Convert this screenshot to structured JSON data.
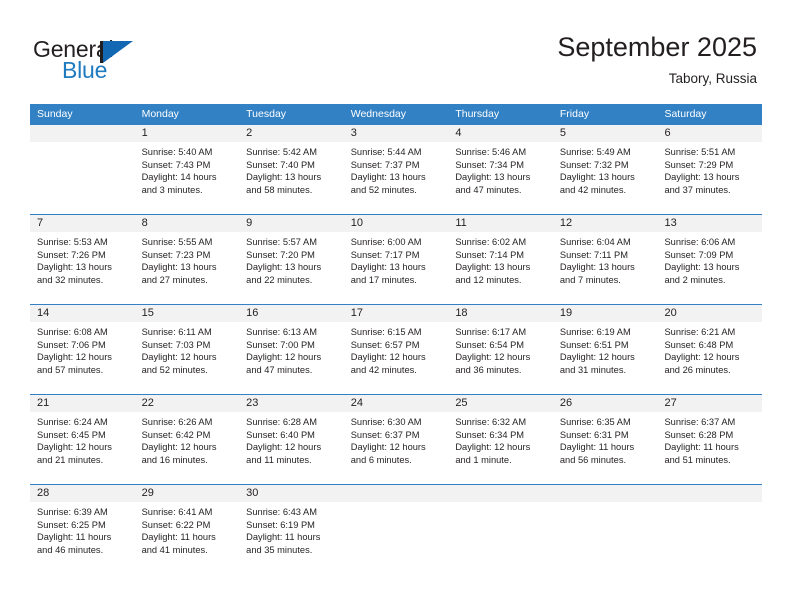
{
  "brand": {
    "name_part1": "General",
    "name_part2": "Blue",
    "logo_icon": "triangle-flag-icon"
  },
  "header": {
    "title": "September 2025",
    "subtitle": "Tabory, Russia"
  },
  "colors": {
    "header_blue": "#3281c4",
    "brand_blue": "#1e7bc0",
    "day_band_gray": "#f2f2f2",
    "text": "#231f20"
  },
  "calendar": {
    "weekdays": [
      "Sunday",
      "Monday",
      "Tuesday",
      "Wednesday",
      "Thursday",
      "Friday",
      "Saturday"
    ],
    "weeks": [
      [
        {
          "day": "",
          "sunrise": "",
          "sunset": "",
          "daylight": "",
          "empty": true
        },
        {
          "day": "1",
          "sunrise": "Sunrise: 5:40 AM",
          "sunset": "Sunset: 7:43 PM",
          "daylight": "Daylight: 14 hours and 3 minutes."
        },
        {
          "day": "2",
          "sunrise": "Sunrise: 5:42 AM",
          "sunset": "Sunset: 7:40 PM",
          "daylight": "Daylight: 13 hours and 58 minutes."
        },
        {
          "day": "3",
          "sunrise": "Sunrise: 5:44 AM",
          "sunset": "Sunset: 7:37 PM",
          "daylight": "Daylight: 13 hours and 52 minutes."
        },
        {
          "day": "4",
          "sunrise": "Sunrise: 5:46 AM",
          "sunset": "Sunset: 7:34 PM",
          "daylight": "Daylight: 13 hours and 47 minutes."
        },
        {
          "day": "5",
          "sunrise": "Sunrise: 5:49 AM",
          "sunset": "Sunset: 7:32 PM",
          "daylight": "Daylight: 13 hours and 42 minutes."
        },
        {
          "day": "6",
          "sunrise": "Sunrise: 5:51 AM",
          "sunset": "Sunset: 7:29 PM",
          "daylight": "Daylight: 13 hours and 37 minutes."
        }
      ],
      [
        {
          "day": "7",
          "sunrise": "Sunrise: 5:53 AM",
          "sunset": "Sunset: 7:26 PM",
          "daylight": "Daylight: 13 hours and 32 minutes."
        },
        {
          "day": "8",
          "sunrise": "Sunrise: 5:55 AM",
          "sunset": "Sunset: 7:23 PM",
          "daylight": "Daylight: 13 hours and 27 minutes."
        },
        {
          "day": "9",
          "sunrise": "Sunrise: 5:57 AM",
          "sunset": "Sunset: 7:20 PM",
          "daylight": "Daylight: 13 hours and 22 minutes."
        },
        {
          "day": "10",
          "sunrise": "Sunrise: 6:00 AM",
          "sunset": "Sunset: 7:17 PM",
          "daylight": "Daylight: 13 hours and 17 minutes."
        },
        {
          "day": "11",
          "sunrise": "Sunrise: 6:02 AM",
          "sunset": "Sunset: 7:14 PM",
          "daylight": "Daylight: 13 hours and 12 minutes."
        },
        {
          "day": "12",
          "sunrise": "Sunrise: 6:04 AM",
          "sunset": "Sunset: 7:11 PM",
          "daylight": "Daylight: 13 hours and 7 minutes."
        },
        {
          "day": "13",
          "sunrise": "Sunrise: 6:06 AM",
          "sunset": "Sunset: 7:09 PM",
          "daylight": "Daylight: 13 hours and 2 minutes."
        }
      ],
      [
        {
          "day": "14",
          "sunrise": "Sunrise: 6:08 AM",
          "sunset": "Sunset: 7:06 PM",
          "daylight": "Daylight: 12 hours and 57 minutes."
        },
        {
          "day": "15",
          "sunrise": "Sunrise: 6:11 AM",
          "sunset": "Sunset: 7:03 PM",
          "daylight": "Daylight: 12 hours and 52 minutes."
        },
        {
          "day": "16",
          "sunrise": "Sunrise: 6:13 AM",
          "sunset": "Sunset: 7:00 PM",
          "daylight": "Daylight: 12 hours and 47 minutes."
        },
        {
          "day": "17",
          "sunrise": "Sunrise: 6:15 AM",
          "sunset": "Sunset: 6:57 PM",
          "daylight": "Daylight: 12 hours and 42 minutes."
        },
        {
          "day": "18",
          "sunrise": "Sunrise: 6:17 AM",
          "sunset": "Sunset: 6:54 PM",
          "daylight": "Daylight: 12 hours and 36 minutes."
        },
        {
          "day": "19",
          "sunrise": "Sunrise: 6:19 AM",
          "sunset": "Sunset: 6:51 PM",
          "daylight": "Daylight: 12 hours and 31 minutes."
        },
        {
          "day": "20",
          "sunrise": "Sunrise: 6:21 AM",
          "sunset": "Sunset: 6:48 PM",
          "daylight": "Daylight: 12 hours and 26 minutes."
        }
      ],
      [
        {
          "day": "21",
          "sunrise": "Sunrise: 6:24 AM",
          "sunset": "Sunset: 6:45 PM",
          "daylight": "Daylight: 12 hours and 21 minutes."
        },
        {
          "day": "22",
          "sunrise": "Sunrise: 6:26 AM",
          "sunset": "Sunset: 6:42 PM",
          "daylight": "Daylight: 12 hours and 16 minutes."
        },
        {
          "day": "23",
          "sunrise": "Sunrise: 6:28 AM",
          "sunset": "Sunset: 6:40 PM",
          "daylight": "Daylight: 12 hours and 11 minutes."
        },
        {
          "day": "24",
          "sunrise": "Sunrise: 6:30 AM",
          "sunset": "Sunset: 6:37 PM",
          "daylight": "Daylight: 12 hours and 6 minutes."
        },
        {
          "day": "25",
          "sunrise": "Sunrise: 6:32 AM",
          "sunset": "Sunset: 6:34 PM",
          "daylight": "Daylight: 12 hours and 1 minute."
        },
        {
          "day": "26",
          "sunrise": "Sunrise: 6:35 AM",
          "sunset": "Sunset: 6:31 PM",
          "daylight": "Daylight: 11 hours and 56 minutes."
        },
        {
          "day": "27",
          "sunrise": "Sunrise: 6:37 AM",
          "sunset": "Sunset: 6:28 PM",
          "daylight": "Daylight: 11 hours and 51 minutes."
        }
      ],
      [
        {
          "day": "28",
          "sunrise": "Sunrise: 6:39 AM",
          "sunset": "Sunset: 6:25 PM",
          "daylight": "Daylight: 11 hours and 46 minutes."
        },
        {
          "day": "29",
          "sunrise": "Sunrise: 6:41 AM",
          "sunset": "Sunset: 6:22 PM",
          "daylight": "Daylight: 11 hours and 41 minutes."
        },
        {
          "day": "30",
          "sunrise": "Sunrise: 6:43 AM",
          "sunset": "Sunset: 6:19 PM",
          "daylight": "Daylight: 11 hours and 35 minutes."
        },
        {
          "day": "",
          "sunrise": "",
          "sunset": "",
          "daylight": "",
          "empty": true
        },
        {
          "day": "",
          "sunrise": "",
          "sunset": "",
          "daylight": "",
          "empty": true
        },
        {
          "day": "",
          "sunrise": "",
          "sunset": "",
          "daylight": "",
          "empty": true
        },
        {
          "day": "",
          "sunrise": "",
          "sunset": "",
          "daylight": "",
          "empty": true
        }
      ]
    ]
  }
}
